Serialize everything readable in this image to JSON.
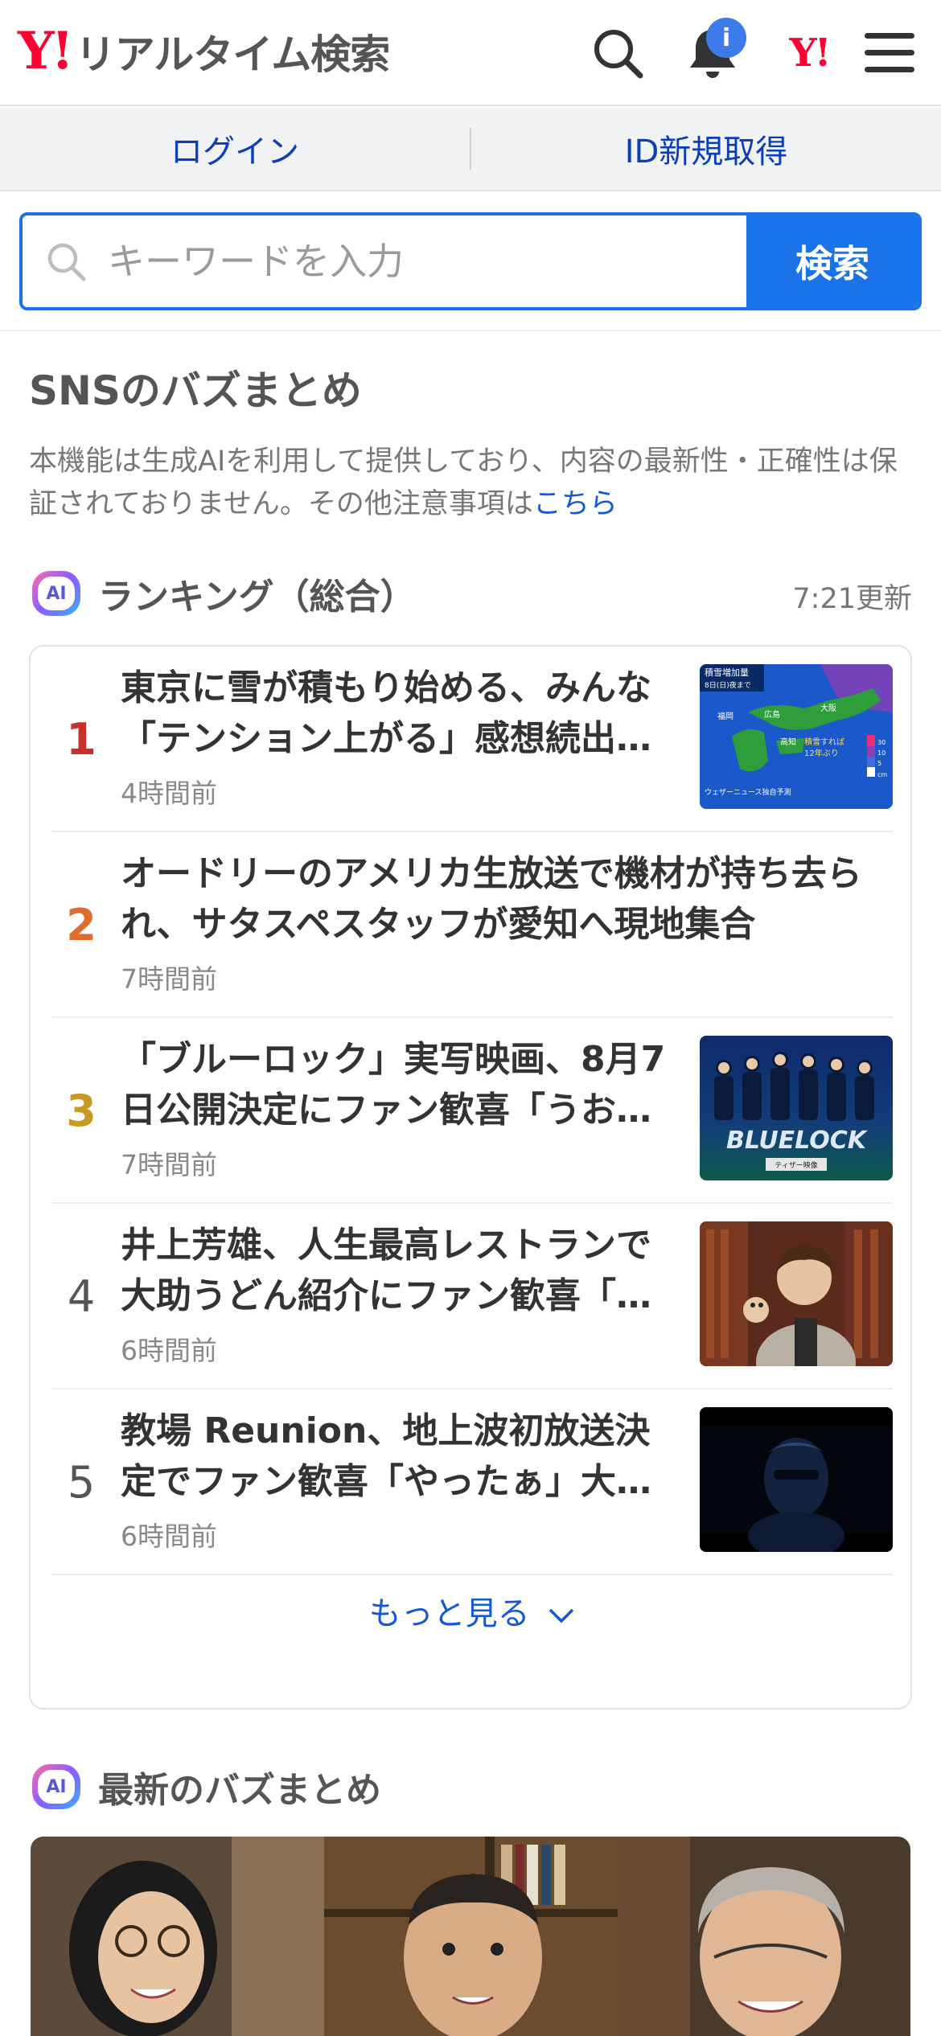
{
  "header": {
    "logo_mark": "Y!",
    "logo_text": "リアルタイム検索",
    "notification_count": "i",
    "yahoo_mark": "Y!"
  },
  "loginbar": {
    "login": "ログイン",
    "signup": "ID新規取得"
  },
  "search": {
    "placeholder": "キーワードを入力",
    "button": "検索"
  },
  "sns_section": {
    "title": "SNSのバズまとめ",
    "notice": "本機能は生成AIを利用して提供しており、内容の最新性・正確性は保証されておりません。その他注意事項は",
    "notice_link": "こちら"
  },
  "ranking": {
    "ai_label": "AI",
    "title": "ランキング（総合）",
    "updated": "7:21更新",
    "items": [
      {
        "rank": "1",
        "title": "東京に雪が積もり始める、みんな「テンション上がる」感想続出…",
        "time": "4時間前"
      },
      {
        "rank": "2",
        "title": "オードリーのアメリカ生放送で機材が持ち去られ、サタスペスタッフが愛知へ現地集合",
        "time": "7時間前"
      },
      {
        "rank": "3",
        "title": "「ブルーロック」実写映画、8月7日公開決定にファン歓喜「うお…",
        "time": "7時間前"
      },
      {
        "rank": "4",
        "title": "井上芳雄、人生最高レストランで大助うどん紹介にファン歓喜「…",
        "time": "6時間前"
      },
      {
        "rank": "5",
        "title": "教場 Reunion、地上波初放送決定でファン歓喜「やったぁ」大…",
        "time": "6時間前"
      }
    ],
    "thumb1": {
      "l1": "積雪増加量",
      "l2": "8日(日)夜まで",
      "l3": "福岡",
      "l4": "広島",
      "l5": "大阪",
      "l6": "高知",
      "l7": "積雪すれば",
      "l8": "12年ぶり",
      "l9": "ウェザーニュース独自予測",
      "s1": "30",
      "s2": "10",
      "s3": "5",
      "s4": "cm"
    },
    "thumb3": {
      "logo": "BLUELOCK",
      "caption": "ティザー映像"
    },
    "more": "もっと見る"
  },
  "latest": {
    "ai_label": "AI",
    "title": "最新のバズまとめ"
  }
}
